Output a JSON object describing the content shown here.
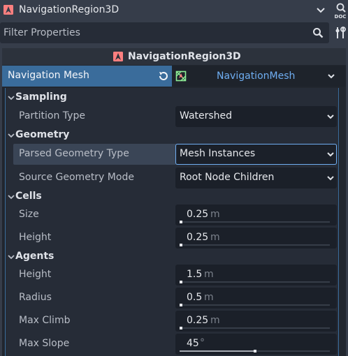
{
  "header": {
    "node_name": "NavigationRegion3D",
    "icons": {
      "node": "navigation-region-icon",
      "history": "chevron-down-icon",
      "docs": "docs-icon"
    }
  },
  "filter": {
    "placeholder": "Filter Properties",
    "value": ""
  },
  "inspector": {
    "object_title": "NavigationRegion3D",
    "navigation_mesh": {
      "label": "Navigation Mesh",
      "value": "NavigationMesh"
    },
    "sections": {
      "sampling": {
        "title": "Sampling",
        "partition_type": {
          "label": "Partition Type",
          "value": "Watershed"
        }
      },
      "geometry": {
        "title": "Geometry",
        "parsed_geometry_type": {
          "label": "Parsed Geometry Type",
          "value": "Mesh Instances"
        },
        "source_geometry_mode": {
          "label": "Source Geometry Mode",
          "value": "Root Node Children"
        }
      },
      "cells": {
        "title": "Cells",
        "size": {
          "label": "Size",
          "value": "0.25",
          "unit": "m",
          "fill_fraction": 0.0
        },
        "height": {
          "label": "Height",
          "value": "0.25",
          "unit": "m",
          "fill_fraction": 0.0
        }
      },
      "agents": {
        "title": "Agents",
        "height": {
          "label": "Height",
          "value": "1.5",
          "unit": "m",
          "fill_fraction": 0.0
        },
        "radius": {
          "label": "Radius",
          "value": "0.5",
          "unit": "m",
          "fill_fraction": 0.0
        },
        "max_climb": {
          "label": "Max Climb",
          "value": "0.25",
          "unit": "m",
          "fill_fraction": 0.0
        },
        "max_slope": {
          "label": "Max Slope",
          "value": "45",
          "unit": "°",
          "fill_fraction": 0.5
        }
      }
    }
  },
  "colors": {
    "accent": "#6faef2",
    "selected_row": "#3a6c9b",
    "node_icon": "#fc7f7f",
    "resource_icon": "#8eef97"
  }
}
